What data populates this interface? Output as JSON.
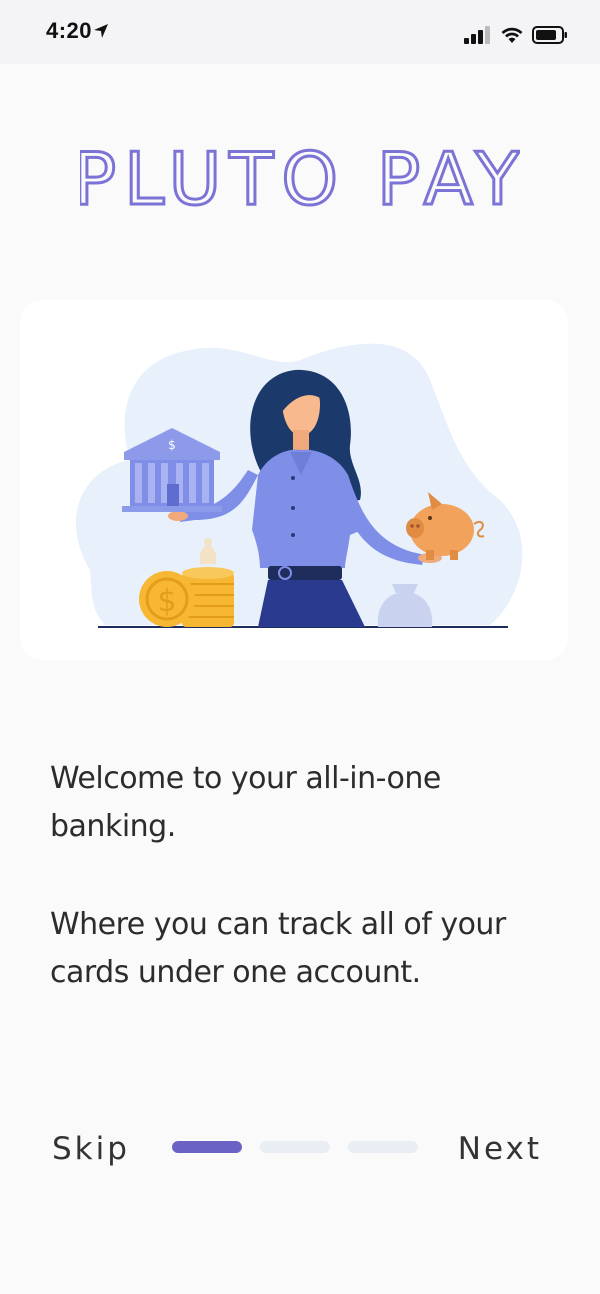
{
  "status_bar": {
    "time": "4:20",
    "icons": [
      "location-arrow-icon",
      "cellular-signal-icon",
      "wifi-icon",
      "battery-icon"
    ]
  },
  "brand": {
    "title": "PLUTO PAY",
    "color": "#7b73d6"
  },
  "hero": {
    "illustration": "woman-holding-bank-and-piggy-bank",
    "bank_symbol": "$",
    "coin_symbol": "$"
  },
  "welcome": {
    "line1": "Welcome to your all-in-one banking.",
    "line2": "Where you can track all of your cards under one account."
  },
  "navigation": {
    "skip_label": "Skip",
    "next_label": "Next",
    "page_count": 3,
    "current_page": 1,
    "active_color": "#6b63c4",
    "inactive_color": "#e9edf4"
  }
}
